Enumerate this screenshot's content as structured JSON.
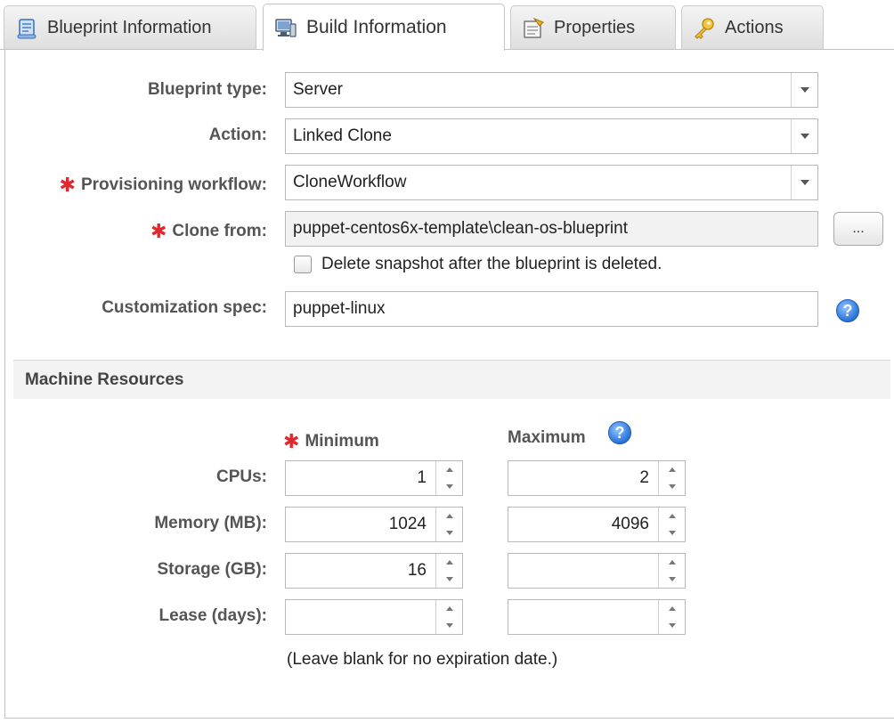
{
  "tabs": [
    {
      "label": "Blueprint Information",
      "icon": "blueprint-scroll-icon",
      "active": false
    },
    {
      "label": "Build Information",
      "icon": "computer-icon",
      "active": true
    },
    {
      "label": "Properties",
      "icon": "properties-icon",
      "active": false
    },
    {
      "label": "Actions",
      "icon": "key-icon",
      "active": false
    }
  ],
  "build": {
    "blueprint_type": {
      "label": "Blueprint type:",
      "value": "Server"
    },
    "action": {
      "label": "Action:",
      "value": "Linked Clone"
    },
    "provisioning_workflow": {
      "label": "Provisioning workflow:",
      "value": "CloneWorkflow",
      "required": true
    },
    "clone_from": {
      "label": "Clone from:",
      "value": "puppet-centos6x-template\\clean-os-blueprint",
      "required": true,
      "browse_label": "..."
    },
    "delete_snapshot": {
      "label": "Delete snapshot after the blueprint is deleted.",
      "checked": false
    },
    "customization_spec": {
      "label": "Customization spec:",
      "value": "puppet-linux"
    }
  },
  "resources": {
    "section_title": "Machine Resources",
    "min_header": "Minimum",
    "max_header": "Maximum",
    "rows": [
      {
        "label": "CPUs:",
        "min": "1",
        "max": "2"
      },
      {
        "label": "Memory (MB):",
        "min": "1024",
        "max": "4096"
      },
      {
        "label": "Storage (GB):",
        "min": "16",
        "max": ""
      },
      {
        "label": "Lease (days):",
        "min": "",
        "max": ""
      }
    ],
    "lease_note": "(Leave blank for no expiration date.)"
  },
  "help_icon_text": "?",
  "required_marker": "✱",
  "colors": {
    "required": "#e0292e",
    "help": "#2a73d8"
  }
}
